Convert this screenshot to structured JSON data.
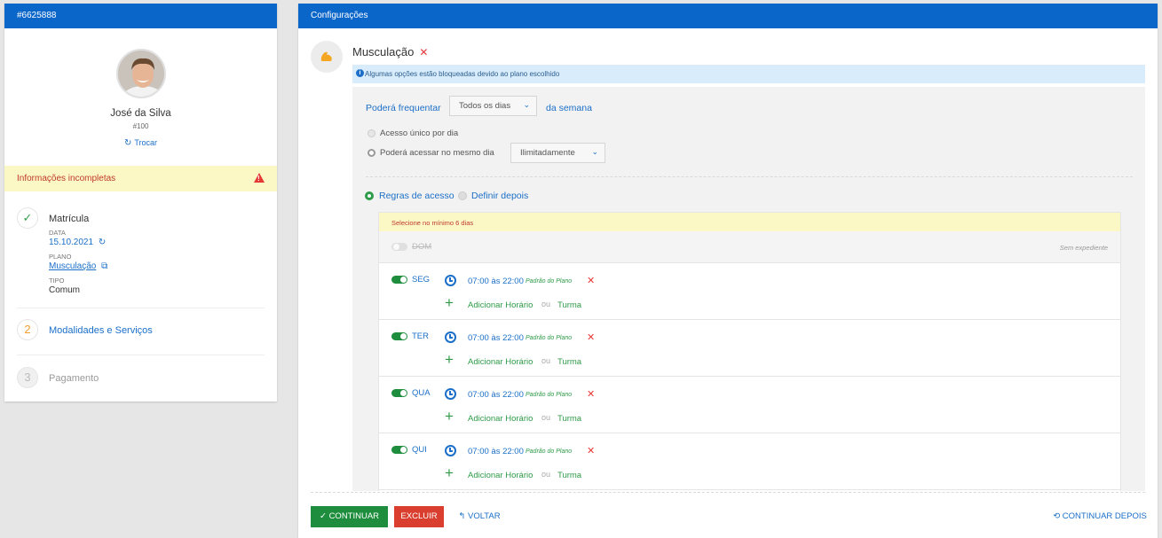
{
  "left": {
    "header": "#6625888",
    "user": {
      "name": "José da Silva",
      "id": "#100",
      "switch_label": "Trocar"
    },
    "warning": "Informações incompletas",
    "steps": {
      "s1": {
        "title": "Matrícula",
        "data_label": "DATA",
        "date": "15.10.2021",
        "plano_label": "PLANO",
        "plano": "Musculação",
        "tipo_label": "TIPO",
        "tipo": "Comum"
      },
      "s2": {
        "number": "2",
        "title": "Modalidades e Serviços"
      },
      "s3": {
        "number": "3",
        "title": "Pagamento"
      }
    }
  },
  "right": {
    "header": "Configurações",
    "modality": "Musculação",
    "info": "Algumas opções estão bloqueadas devido ao plano escolhido",
    "frequency": {
      "label": "Poderá frequentar",
      "selected": "Todos os dias",
      "suffix": "da semana"
    },
    "access": {
      "single": "Acesso único por dia",
      "multi": "Poderá acessar no mesmo dia",
      "multi_selected": "Ilimitadamente"
    },
    "rules": {
      "option1": "Regras de acesso",
      "option2": "Definir depois"
    },
    "days_warning": "Selecione no mínimo 6 dias",
    "sunday": {
      "label": "DOM",
      "status": "Sem expediente"
    },
    "days": [
      {
        "label": "SEG",
        "hours": "07:00 às 22:00",
        "tag": "Padrão do Plano"
      },
      {
        "label": "TER",
        "hours": "07:00 às 22:00",
        "tag": "Padrão do Plano"
      },
      {
        "label": "QUA",
        "hours": "07:00 às 22:00",
        "tag": "Padrão do Plano"
      },
      {
        "label": "QUI",
        "hours": "07:00 às 22:00",
        "tag": "Padrão do Plano"
      }
    ],
    "day_actions": {
      "add": "Adicionar Horário",
      "or": "ou",
      "class": "Turma"
    },
    "buttons": {
      "continue": "CONTINUAR",
      "delete": "EXCLUIR",
      "back": "VOLTAR",
      "later": "CONTINUAR DEPOIS"
    }
  },
  "colors": {
    "primary": "#0b66c9",
    "success": "#1e8e3e",
    "danger": "#d93e2e",
    "warning_bg": "#fcf8c6",
    "info_bg": "#d8ecfb"
  }
}
